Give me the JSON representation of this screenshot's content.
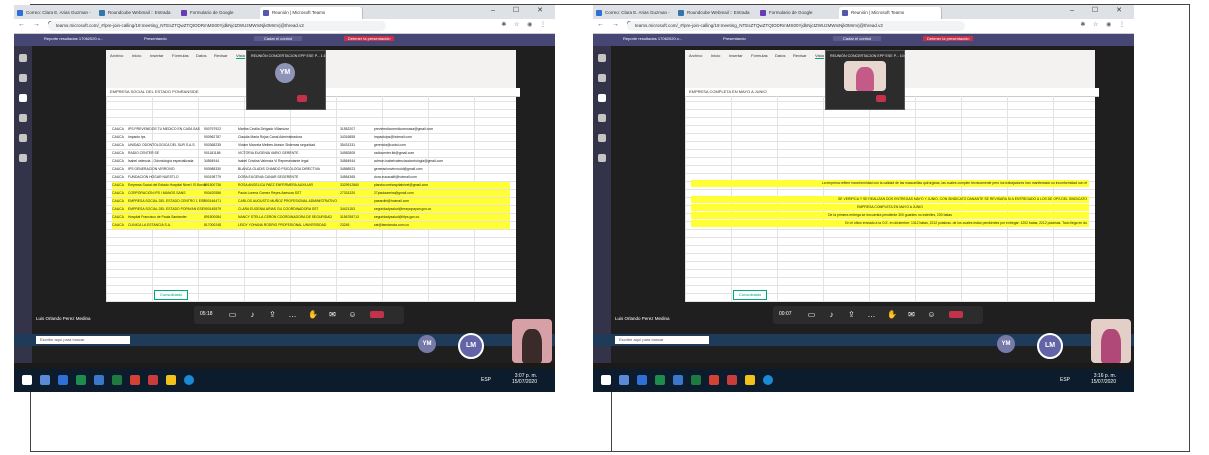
{
  "screens": [
    {
      "tabs": [
        {
          "label": "Correo: Clara E. Arias Guzman -",
          "color": "#2f6fd6"
        },
        {
          "label": "Roundcube Webmail :: Entrada",
          "color": "#37a"
        },
        {
          "label": "Formulario de Google",
          "color": "#673ab7"
        },
        {
          "label": "Reunión | Microsoft Teams",
          "color": "#5558af"
        }
      ],
      "url": "teams.microsoft.com/_#/pre-join-calling/19:meeting_NTEsZTQwZTQtODRmMS00YjdkNjctZWUzMWIxNjk0MmVj@thread.v2",
      "teams_bar": {
        "left": "Reporte resultados 17062020.x...",
        "mid": "Presentando",
        "search": "Cadar el control",
        "stop": "Detener la presentación"
      },
      "excel_menu": [
        "Archivo",
        "Inicio",
        "Insertar",
        "Fórmulas",
        "Datos",
        "Revisar",
        "Vista"
      ],
      "formula": "EMPRESA SOCIAL DEL ESTADO PONRANSIDE",
      "rows": [
        {
          "a": "CAUCA",
          "b": "IPS PREVENIDOS TU MEDICO EN CASA SAS",
          "c": "900797922",
          "d": "Martha Cecilia Delgado Villamizar",
          "e": "31552207",
          "f": "previmedicomedicoencasa@gmail.com",
          "hl": false
        },
        {
          "a": "CAUCA",
          "b": "Impacto ips",
          "c": "900962787",
          "d": "Claudia Maria Rojas Canal Administradora",
          "e": "34316855",
          "f": "impactoips@hotmail.com",
          "hl": false
        },
        {
          "a": "CAUCA",
          "b": "UNIDAD ODONTOLOGICA DEL SUR S.A.S.",
          "c": "900368235",
          "d": "Viviam Marcela Melbes Asesor Sistemas seguridad",
          "e": "35431331",
          "f": "gerencia@uodsl.com",
          "hl": false
        },
        {
          "a": "CAUCA",
          "b": "RADIO CENTER SE",
          "c": "901181186",
          "d": "VICTORIA EUGENIA VARIO GERENTE",
          "e": "34982805",
          "f": "radiocenter.ltd@gmail.com",
          "hl": false
        },
        {
          "a": "CAUCA",
          "b": "Isabel valencia - Odontología especializada",
          "c": "34564944",
          "d": "Isabel Cristina Valencia Vi Representante legal",
          "e": "34564944",
          "f": "admon.isabelvalenciaodontologia@gmail.com",
          "hl": false
        },
        {
          "a": "CAUCA",
          "b": "IPS GENERACION VIRROVID",
          "c": "900988330",
          "d": "BLANCA GLADIS CHANDO PSICOLOGA DIRECTIVA",
          "e": "34568923",
          "f": "generacionvirrovoid@gmail.com",
          "hl": false
        },
        {
          "a": "CAUCA",
          "b": "FUNDACION HOGAR NUESTLO",
          "c": "900198779",
          "d": "DORA EUGENIA CANAR SEGERENTE",
          "e": "34564365",
          "f": "dora.eucacalif@hotmail.com",
          "hl": false
        },
        {
          "a": "CAUCA",
          "b": "Empresa Social del Estado Hospital Nivel I El Bordo",
          "c": "891500736",
          "d": "ROSA ANGELICA PAEZ ENFERMERA AUXILIAR",
          "e": "3329912660",
          "f": "plandocumhospitalnivel@gmail.com",
          "hl": true
        },
        {
          "a": "CAUCA",
          "b": "CORPORACION IPS I MANOS SANS",
          "c": "900420556",
          "d": "Paola Lorena Gomez Reyes Asesora SST",
          "e": "27331320",
          "f": "27paolaareira@gmail.com",
          "hl": true
        },
        {
          "a": "CAUCA",
          "b": "EMPRESA SOCIAL DEL ESTADO CENTRO 1 ESE",
          "c": "900146471",
          "d": "CARLOS AUGUSTO MUÑOZ PROFESIONAL ADMINISTRATIVO",
          "e": "",
          "f": "paeardirt@hotmail.com",
          "hl": true
        },
        {
          "a": "CAUCA",
          "b": "EMPRESA SOCIAL DEL ESTADO POPAYAN ESE",
          "c": "900145579",
          "d": "CLARA EUGENIA ARIAS GU COORDINADORA SST",
          "e": "34421153",
          "f": "seguridadysalud@esepopayan.gov.co",
          "hl": true
        },
        {
          "a": "CAUCA",
          "b": "Hospital Francisco de Paula Santander",
          "c": "891500084",
          "d": "NANCY STELLA CERON COORDINADORA DE SEGURIDAD",
          "e": "3156788713",
          "f": "seguridadysalud@hfps.gov.co",
          "hl": true
        },
        {
          "a": "CAUCA",
          "b": "CLINICA LA ESTANCIA S.A.",
          "c": "817000248",
          "d": "LEIDY YOHANA RODRIG PROFESIONAL UNIVERSIDAD",
          "e": "23245",
          "f": "sst@laestancia.com.co",
          "hl": true
        }
      ],
      "meeting_title": "REUNIÓN CONCERTACION EPP ESE P... 1:19",
      "meeting_initials": "YM",
      "call_timer": "05:18",
      "sheet_tab": "Consolidado",
      "presenter": "Luis Orlando Perez Medina",
      "search_placeholder": "Escribe aquí para buscar",
      "win_time": "3:04 p. m.",
      "win_date": "15/07/2020",
      "main_time": "3:07 p. m.",
      "main_date": "15/07/2020",
      "lang": "ESP"
    },
    {
      "tabs": [
        {
          "label": "Correo: Clara E. Arias Guzman -",
          "color": "#2f6fd6"
        },
        {
          "label": "Roundcube Webmail :: Entrada",
          "color": "#37a"
        },
        {
          "label": "Formulario de Google",
          "color": "#673ab7"
        },
        {
          "label": "Reunión | Microsoft Teams",
          "color": "#5558af"
        }
      ],
      "url": "teams.microsoft.com/_#/pre-join-calling/19:meeting_NTEsZTQwZTQtODRmMS00YjdkNjctZWUzMWIxNjk0MmVj@thread.v2",
      "teams_bar": {
        "left": "Reporte resultados 17062020.x...",
        "mid": "Presentando",
        "search": "Cadar el control",
        "stop": "Detener la presentación"
      },
      "excel_menu": [
        "Archivo",
        "Inicio",
        "Insertar",
        "Fórmulas",
        "Datos",
        "Revisar",
        "Vista"
      ],
      "formula": "EMPRESA COMPLETA EN MAYO A JUNIO",
      "notes": [
        "La empresa refiere inconformidad con la calidad de las mascarillas quirúrgicas, las cuales cumplen técnicamente pero los trabajadores han manifestado su inconformidad con el",
        "SE VERIFICA Y SE REALIZAN DOS ENTREGAS MAYO Y JUNIO, CON SINDICATO DANANTE SE REVISARA SI A ENTREGADO A LOS DE OPS DEL SINDICATO",
        "EMPRESA COMPLETA EN MAYO A JUNIO",
        "De la primera entrega se encuentra pendiente 300 guantes no estériles, 200 batas",
        "En el oficio enviado a la O.E. en diciembre: 1312 batas, 2212 polainas. de los cuales están pendientes por entregar: 1202 batas, 2212 polainas. Todo llega en du"
      ],
      "meeting_title": "REUNIÓN CONCERTACION EPP ESE P... 10:07",
      "call_timer": "00:07",
      "sheet_tab": "Consolidado",
      "presenter": "Luis Orlando Perez Medina",
      "search_placeholder": "Escribe aquí para buscar",
      "win_time": "3:16 p. m.",
      "win_date": "15/07/2020",
      "main_time": "3:16 p. m.",
      "main_date": "15/07/2020",
      "lang": "ESP",
      "avatar_ym": "YM",
      "avatar_lm": "LM"
    }
  ]
}
